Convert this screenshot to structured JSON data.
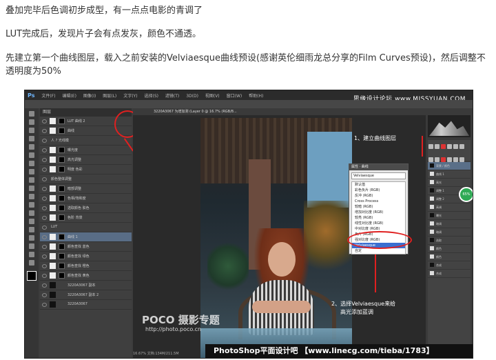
{
  "article": {
    "p1": "叠加完毕后色调初步成型，有一点点电影的青调了",
    "p2": "LUT完成后，发现片子会有点发灰，颜色不通透。",
    "p3": "先建立第一个曲线图层，载入之前安装的Velviaesque曲线预设(感谢英伦细雨龙总分享的Film Curves预设)，然后调整不透明度为50%"
  },
  "ps": {
    "logo": "Ps",
    "menus": [
      "文件(F)",
      "编辑(E)",
      "图像(I)",
      "图层(L)",
      "文字(Y)",
      "选择(S)",
      "滤镜(T)",
      "3D(D)",
      "视图(V)",
      "窗口(W)",
      "帮助(H)"
    ],
    "watermark_top": "思缘设计论坛 www.MISSYUAN.COM",
    "doc_tab": "3220A3067 为增加测 (Layer 0 @ 16.7% (RGB/8...",
    "layers_header": "图层",
    "left_layers": [
      {
        "label": "LUT 曲线 2",
        "type": "adj",
        "sel": false
      },
      {
        "label": "曲线",
        "type": "adj",
        "sel": false
      },
      {
        "label": "人 ? 光线模",
        "type": "group",
        "sel": false
      },
      {
        "label": "曝光度",
        "type": "adj",
        "sel": false
      },
      {
        "label": "高光调整",
        "type": "adj",
        "sel": false
      },
      {
        "label": "明度 色彩",
        "type": "adj",
        "sel": false
      },
      {
        "label": "颜色整体调整",
        "type": "group",
        "sel": false
      },
      {
        "label": "暗部调整",
        "type": "adj",
        "sel": false
      },
      {
        "label": "色相/饱和度",
        "type": "adj",
        "sel": false
      },
      {
        "label": "选取颜色 肤色",
        "type": "adj",
        "sel": false
      },
      {
        "label": "色阶 背景",
        "type": "adj",
        "sel": false
      },
      {
        "label": "LUT",
        "type": "group",
        "sel": false
      },
      {
        "label": "曲线 1",
        "type": "adj",
        "sel": true
      },
      {
        "label": "颜色查找 蓝色",
        "type": "adj",
        "sel": false
      },
      {
        "label": "颜色查找 绿色",
        "type": "adj",
        "sel": false
      },
      {
        "label": "颜色查找 橙色",
        "type": "adj",
        "sel": false
      },
      {
        "label": "颜色查找 黄色",
        "type": "adj",
        "sel": false
      },
      {
        "label": "3220A3067 副本",
        "type": "img",
        "sel": false
      },
      {
        "label": "3220A3067 副本 2",
        "type": "img",
        "sel": false
      },
      {
        "label": "3220A3067",
        "type": "img",
        "sel": false
      }
    ],
    "curves": {
      "title": "属性 · 曲线",
      "preset": "Velviaesque",
      "items": [
        "默认值",
        "彩色负片 (RGB)",
        "反冲 (RGB)",
        "Cross Process",
        "较暗 (RGB)",
        "增加对比度 (RGB)",
        "较亮 (RGB)",
        "线性对比度 (RGB)",
        "中对比度 (RGB)",
        "负片 (RGB)",
        "强对比度 (RGB)",
        "Velviaesque",
        "自定"
      ],
      "highlight_index": 11
    },
    "annotations": {
      "a1": "1、建立曲线图层",
      "a2": "2、选择Velviaesque来给",
      "a3": "高光添加蓝调"
    },
    "right_layers": [
      "背景 / 颜色",
      "曲线 1",
      "高光",
      "调整 1",
      "调整 2",
      "高调",
      "曝光",
      "暗调",
      "暗调",
      "选取",
      "颜色",
      "颜色",
      "合成",
      "合成"
    ],
    "badge": "65%",
    "poco_logo": "POCO 摄影专题",
    "poco_url": "http://photo.poco.cn",
    "status": "16.67%  文档:134M/211.5M",
    "footer": "PhotoShop平面设计吧 【www.linecg.com/tieba/1783】"
  },
  "colors": {
    "annotation_red": "#e02020",
    "ps_bg": "#3c3c3c",
    "selected_layer": "#596d86"
  }
}
